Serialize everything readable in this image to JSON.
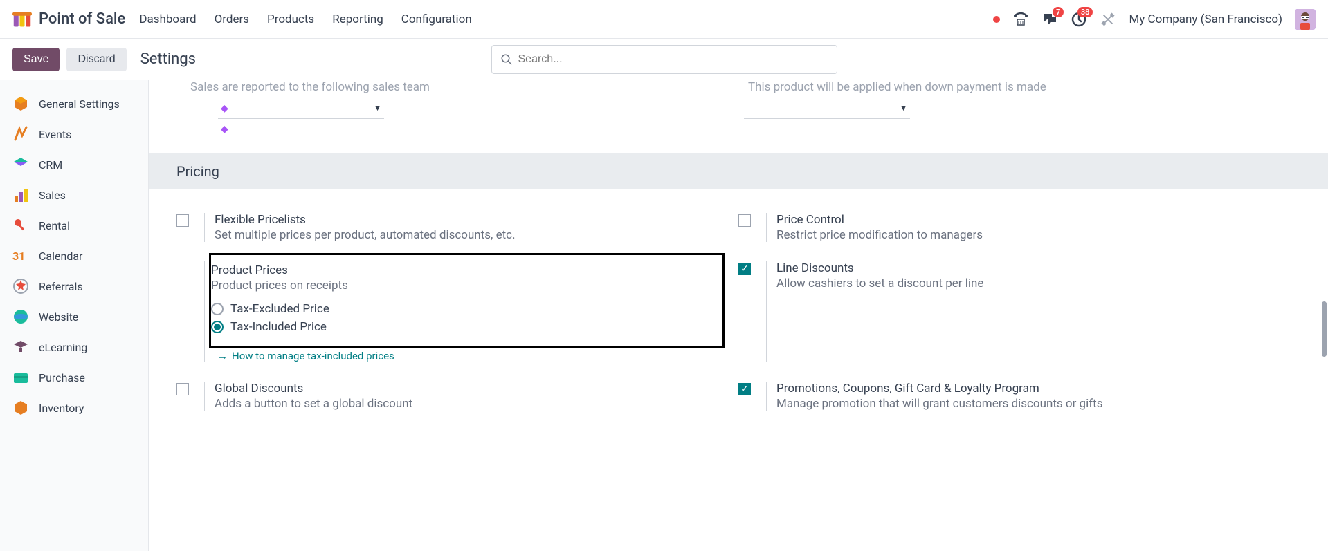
{
  "app": {
    "title": "Point of Sale"
  },
  "nav": {
    "dashboard": "Dashboard",
    "orders": "Orders",
    "products": "Products",
    "reporting": "Reporting",
    "configuration": "Configuration"
  },
  "topbar": {
    "chat_badge": "7",
    "clock_badge": "38",
    "company": "My Company (San Francisco)"
  },
  "actions": {
    "save": "Save",
    "discard": "Discard",
    "page_title": "Settings"
  },
  "search": {
    "placeholder": "Search..."
  },
  "sidebar": {
    "general": "General Settings",
    "events": "Events",
    "crm": "CRM",
    "sales": "Sales",
    "rental": "Rental",
    "calendar": "Calendar",
    "referrals": "Referrals",
    "website": "Website",
    "elearning": "eLearning",
    "purchase": "Purchase",
    "inventory": "Inventory"
  },
  "partial": {
    "left": "Sales are reported to the following sales team",
    "right": "This product will be applied when down payment is made"
  },
  "section": {
    "pricing": "Pricing"
  },
  "settings": {
    "flex_title": "Flexible Pricelists",
    "flex_desc": "Set multiple prices per product, automated discounts, etc.",
    "pc_title": "Price Control",
    "pc_desc": "Restrict price modification to managers",
    "pp_title": "Product Prices",
    "pp_desc": "Product prices on receipts",
    "pp_opt1": "Tax-Excluded Price",
    "pp_opt2": "Tax-Included Price",
    "pp_help": "How to manage tax-included prices",
    "ld_title": "Line Discounts",
    "ld_desc": "Allow cashiers to set a discount per line",
    "gd_title": "Global Discounts",
    "gd_desc": "Adds a button to set a global discount",
    "promo_title": "Promotions, Coupons, Gift Card & Loyalty Program",
    "promo_desc": "Manage promotion that will grant customers discounts or gifts"
  }
}
